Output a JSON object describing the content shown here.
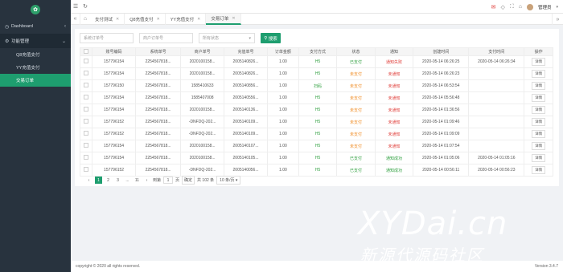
{
  "sidebar": {
    "items": [
      {
        "label": "Dashboard"
      },
      {
        "label": "功能管理"
      }
    ],
    "sub_items": [
      {
        "label": "Q8充值支付"
      },
      {
        "label": "YY充值支付"
      },
      {
        "label": "交易订单"
      }
    ]
  },
  "topbar": {
    "user": "管理员"
  },
  "tabs": [
    {
      "label": "支付测试"
    },
    {
      "label": "Q8充值支付"
    },
    {
      "label": "YY充值支付"
    },
    {
      "label": "交易订单"
    }
  ],
  "filters": {
    "system_order_placeholder": "系统订单号",
    "merchant_order_placeholder": "商户订单号",
    "status_placeholder": "所有状态",
    "search_label": "搜索"
  },
  "table": {
    "headers": [
      "",
      "账号编码",
      "系统单号",
      "商户单号",
      "充值单号",
      "订单金额",
      "支付方式",
      "状态",
      "通知",
      "创建时间",
      "支付时间",
      "操作"
    ],
    "rows": [
      [
        "157796154",
        "2254567818...",
        "2020100158...",
        "2005140826...",
        "1.00",
        "H5",
        "已支付",
        "通知失败",
        "2020-05-14 06:26:25",
        "2020-05-14 06:26:34",
        "详情"
      ],
      [
        "157796154",
        "2254567818...",
        "2020100158...",
        "2005140826...",
        "1.00",
        "H5",
        "未支付",
        "未通知",
        "2020-05-14 06:26:23",
        "",
        "详情"
      ],
      [
        "157796150",
        "2254567818...",
        "1585410633",
        "2005140856...",
        "1.00",
        "扫码",
        "未支付",
        "未通知",
        "2020-05-14 06:53:54",
        "",
        "详情"
      ],
      [
        "157796154",
        "2254567818...",
        "1585407008",
        "2005140556...",
        "1.00",
        "H5",
        "未支付",
        "未通知",
        "2020-05-14 05:56:48",
        "",
        "详情"
      ],
      [
        "157796154",
        "2254567818...",
        "2020100158...",
        "2005140136...",
        "1.00",
        "H5",
        "未支付",
        "未通知",
        "2020-05-14 01:36:56",
        "",
        "详情"
      ],
      [
        "157796152",
        "2254567818...",
        "-DNFDQ-202...",
        "2005140109...",
        "1.00",
        "H5",
        "未支付",
        "未通知",
        "2020-05-14 01:09:46",
        "",
        "详情"
      ],
      [
        "157796152",
        "2254567818...",
        "-DNFDQ-202...",
        "2005140109...",
        "1.00",
        "H5",
        "未支付",
        "未通知",
        "2020-05-14 01:09:09",
        "",
        "详情"
      ],
      [
        "157796154",
        "2254567818...",
        "2020100158...",
        "2005140107...",
        "1.00",
        "H5",
        "未支付",
        "未通知",
        "2020-05-14 01:07:54",
        "",
        "详情"
      ],
      [
        "157796154",
        "2254567818...",
        "2020100158...",
        "2005140105...",
        "1.00",
        "H5",
        "已支付",
        "通知成功",
        "2020-05-14 01:05:06",
        "2020-05-14 01:05:16",
        "详情"
      ],
      [
        "157796152",
        "2254567818...",
        "-DNFDQ-202...",
        "2005140056...",
        "1.00",
        "H5",
        "已支付",
        "通知成功",
        "2020-05-14 00:56:11",
        "2020-05-14 00:56:23",
        "详情"
      ]
    ]
  },
  "pager": {
    "pages": [
      "1",
      "2",
      "3",
      "...",
      "11"
    ],
    "goto_label": "到第",
    "page_input": "1",
    "page_unit": "页",
    "confirm_label": "确定",
    "total": "共 102 条",
    "per_page": "10 条/页"
  },
  "footer": {
    "copyright": "copyright © 2020 all rights reserved.",
    "version": "Version 3.4.7"
  },
  "watermark": {
    "line1": "XYDai.cn",
    "line2": "新源代源码社区"
  },
  "colors": {
    "accent": "#1e9e6f",
    "sidebar": "#28333e",
    "paid": "#2e9f3e",
    "unpaid": "#f08c23",
    "fail": "#e0403c"
  }
}
